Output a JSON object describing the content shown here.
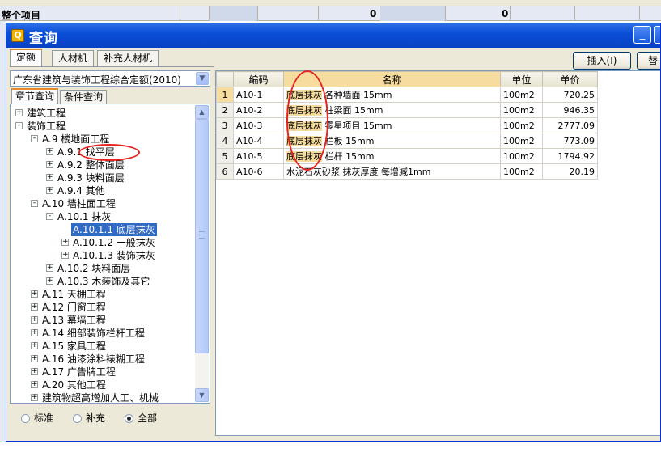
{
  "background": {
    "row_label": "整个项目",
    "totals": [
      "0",
      "0"
    ]
  },
  "dialog": {
    "title": "查询",
    "title_icon": "query-app-icon",
    "tabs": [
      "定额",
      "人材机",
      "补充人材机"
    ],
    "insert_label": "插入(I)",
    "replace_label": "替",
    "dropdown_value": "广东省建筑与装饰工程综合定额(2010)",
    "query_tabs": [
      "章节查询",
      "条件查询"
    ],
    "tree": [
      {
        "label": "建筑工程",
        "level": 0,
        "expander": "+"
      },
      {
        "label": "装饰工程",
        "level": 0,
        "expander": "-"
      },
      {
        "label": "A.9 楼地面工程",
        "level": 1,
        "expander": "-"
      },
      {
        "label": "A.9.1 找平层",
        "level": 2,
        "expander": "+"
      },
      {
        "label": "A.9.2 整体面层",
        "level": 2,
        "expander": "+"
      },
      {
        "label": "A.9.3 块料面层",
        "level": 2,
        "expander": "+"
      },
      {
        "label": "A.9.4 其他",
        "level": 2,
        "expander": "+"
      },
      {
        "label": "A.10 墙柱面工程",
        "level": 1,
        "expander": "-"
      },
      {
        "label": "A.10.1 抹灰",
        "level": 2,
        "expander": "-"
      },
      {
        "label": "A.10.1.1 底层抹灰",
        "level": 3,
        "expander": "",
        "selected": true
      },
      {
        "label": "A.10.1.2 一般抹灰",
        "level": 3,
        "expander": "+"
      },
      {
        "label": "A.10.1.3 装饰抹灰",
        "level": 3,
        "expander": "+"
      },
      {
        "label": "A.10.2 块料面层",
        "level": 2,
        "expander": "+"
      },
      {
        "label": "A.10.3 木装饰及其它",
        "level": 2,
        "expander": "+"
      },
      {
        "label": "A.11 天棚工程",
        "level": 1,
        "expander": "+"
      },
      {
        "label": "A.12 门窗工程",
        "level": 1,
        "expander": "+"
      },
      {
        "label": "A.13 幕墙工程",
        "level": 1,
        "expander": "+"
      },
      {
        "label": "A.14 细部装饰栏杆工程",
        "level": 1,
        "expander": "+"
      },
      {
        "label": "A.15 家具工程",
        "level": 1,
        "expander": "+"
      },
      {
        "label": "A.16 油漆涂料裱糊工程",
        "level": 1,
        "expander": "+"
      },
      {
        "label": "A.17 广告牌工程",
        "level": 1,
        "expander": "+"
      },
      {
        "label": "A.20 其他工程",
        "level": 1,
        "expander": "+"
      },
      {
        "label": "建筑物超高增加人工、机械",
        "level": 1,
        "expander": "+"
      }
    ],
    "radios": [
      {
        "label": "标准",
        "checked": false
      },
      {
        "label": "补充",
        "checked": false
      },
      {
        "label": "全部",
        "checked": true
      }
    ],
    "grid": {
      "columns": [
        "编码",
        "名称",
        "单位",
        "单价"
      ],
      "rows": [
        {
          "idx": "1",
          "code": "A10-1",
          "name_hl": "底层抹灰",
          "name_rest": " 各种墙面 15mm",
          "unit": "100m2",
          "price": "720.25"
        },
        {
          "idx": "2",
          "code": "A10-2",
          "name_hl": "底层抹灰",
          "name_rest": " 柱梁面 15mm",
          "unit": "100m2",
          "price": "946.35"
        },
        {
          "idx": "3",
          "code": "A10-3",
          "name_hl": "底层抹灰",
          "name_rest": " 零星项目 15mm",
          "unit": "100m2",
          "price": "2777.09"
        },
        {
          "idx": "4",
          "code": "A10-4",
          "name_hl": "底层抹灰",
          "name_rest": " 栏板 15mm",
          "unit": "100m2",
          "price": "773.09"
        },
        {
          "idx": "5",
          "code": "A10-5",
          "name_hl": "底层抹灰",
          "name_rest": " 栏杆 15mm",
          "unit": "100m2",
          "price": "1794.92"
        },
        {
          "idx": "6",
          "code": "A10-6",
          "name_hl": "",
          "name_rest": "水泥石灰砂浆 抹灰厚度 每增减1mm",
          "unit": "100m2",
          "price": "20.19"
        }
      ]
    }
  },
  "colors": {
    "title_bar": "#0a4fd8",
    "selection": "#316ac5",
    "highlight": "#f6dc9e",
    "annotation": "#e8231f"
  }
}
